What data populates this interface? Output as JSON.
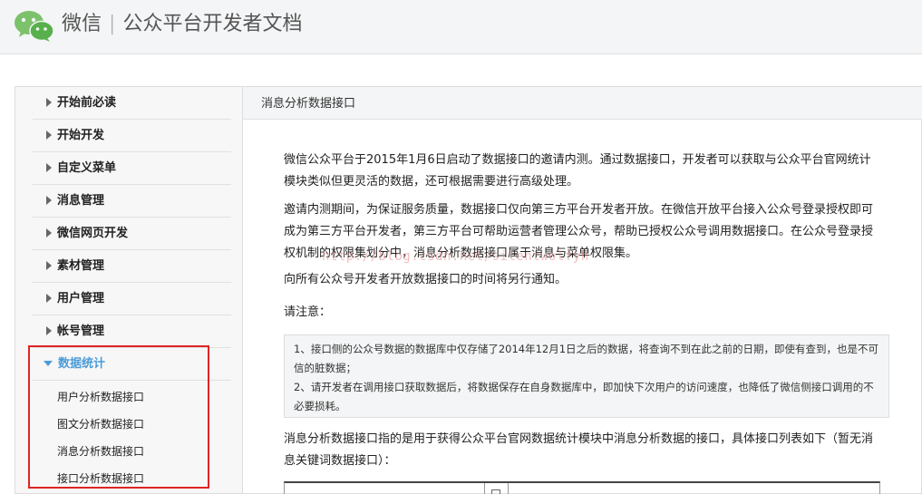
{
  "header": {
    "brand": "微信",
    "separator": "|",
    "subtitle": "公众平台开发者文档"
  },
  "sidebar": {
    "items": [
      {
        "label": "开始前必读"
      },
      {
        "label": "开始开发"
      },
      {
        "label": "自定义菜单"
      },
      {
        "label": "消息管理"
      },
      {
        "label": "微信网页开发"
      },
      {
        "label": "素材管理"
      },
      {
        "label": "用户管理"
      },
      {
        "label": "帐号管理"
      },
      {
        "label": "数据统计"
      }
    ],
    "sub_items": [
      {
        "label": "用户分析数据接口"
      },
      {
        "label": "图文分析数据接口"
      },
      {
        "label": "消息分析数据接口"
      },
      {
        "label": "接口分析数据接口"
      }
    ]
  },
  "content": {
    "title": "消息分析数据接口",
    "p1": "微信公众平台于2015年1月6日启动了数据接口的邀请内测。通过数据接口，开发者可以获取与公众平台官网统计模块类似但更灵活的数据，还可根据需要进行高级处理。",
    "p2": "邀请内测期间，为保证服务质量，数据接口仅向第三方平台开发者开放。在微信开放平台接入公众号登录授权即可成为第三方平台开发者，第三方平台可帮助运营者管理公众号，帮助已授权公众号调用数据接口。在公众号登录授权机制的权限集划分中，消息分析数据接口属于消息与菜单权限集。",
    "p3": "向所有公众号开发者开放数据接口的时间将另行通知。",
    "notice_label": "请注意：",
    "notes": [
      "1、接口侧的公众号数据的数据库中仅存储了2014年12月1日之后的数据，将查询不到在此之前的日期，即使有查到，也是不可信的脏数据；",
      "2、请开发者在调用接口获取数据后，将数据保存在自身数据库中，即加快下次用户的访问速度，也降低了微信侧接口调用的不必要损耗。"
    ],
    "p4": "消息分析数据接口指的是用于获得公众平台官网数据统计模块中消息分析数据的接口，具体接口列表如下（暂无消息关键词数据接口）："
  },
  "watermark": "http://blog.csdn.net/silentwolfyh",
  "colors": {
    "accent": "#4b9bd6",
    "highlight": "#e02424",
    "brand_green": "#44b549"
  }
}
